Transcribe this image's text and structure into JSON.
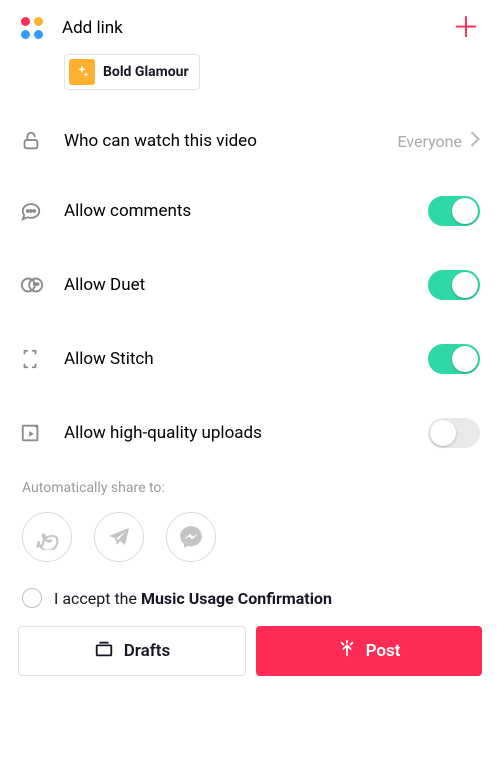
{
  "header": {
    "add_link_label": "Add link"
  },
  "filter_chip": {
    "label": "Bold Glamour"
  },
  "settings": {
    "visibility": {
      "label": "Who can watch this video",
      "value": "Everyone"
    },
    "allow_comments": {
      "label": "Allow comments",
      "on": true
    },
    "allow_duet": {
      "label": "Allow Duet",
      "on": true
    },
    "allow_stitch": {
      "label": "Allow Stitch",
      "on": true
    },
    "allow_hq": {
      "label": "Allow high-quality uploads",
      "on": false
    }
  },
  "share": {
    "label": "Automatically share to:"
  },
  "accept": {
    "prefix": "I accept the ",
    "bold": "Music Usage Confirmation"
  },
  "buttons": {
    "drafts": "Drafts",
    "post": "Post"
  }
}
